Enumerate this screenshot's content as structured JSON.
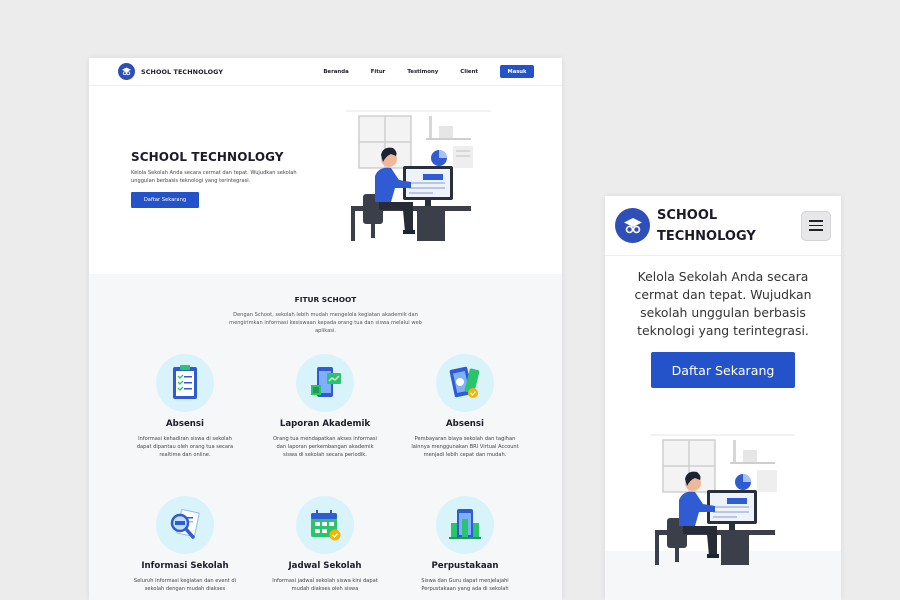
{
  "desktop": {
    "nav": {
      "brand": "SCHOOL TECHNOLOGY",
      "links": [
        "Beranda",
        "Fitur",
        "Testimony",
        "Client"
      ],
      "login": "Masuk"
    },
    "hero": {
      "title": "SCHOOL TECHNOLOGY",
      "description": "Kelola Sekolah Anda secara cermat dan tepat. Wujudkan sekolah unggulan berbasis teknologi yang terintegrasi.",
      "cta": "Daftar Sekarang"
    },
    "features": {
      "title": "FITUR SCHOOT",
      "description": "Dengan Schoot, sekolah lebih mudah mengelola kegiatan akademik dan mengirimkan informasi kesiswaan kepada orang tua dan siswa melalui web aplikasi.",
      "cards": [
        {
          "icon": "clipboard-checklist-icon",
          "title": "Absensi",
          "text": "Informasi kehadiran siswa di sekolah dapat dipantau oleh orang tua secara realtime dan online."
        },
        {
          "icon": "report-chart-icon",
          "title": "Laporan Akademik",
          "text": "Orang tua mendapatkan akses informasi dan laporan perkembangan akademik siswa di sekolah secara periodik."
        },
        {
          "icon": "payment-card-icon",
          "title": "Absensi",
          "text": "Pembayaran biaya sekolah dan tagihan lainnya menggunakan BRI Virtual Account menjadi lebih cepat dan mudah."
        },
        {
          "icon": "magnifier-document-icon",
          "title": "Informasi Sekolah",
          "text": "Seluruh informasi kegiatan dan event di sekolah dengan mudah diakses"
        },
        {
          "icon": "calendar-icon",
          "title": "Jadwal Sekolah",
          "text": "Informasi jadwal sekolah siswa kini dapat mudah diakses oleh siswa"
        },
        {
          "icon": "library-books-icon",
          "title": "Perpustakaan",
          "text": "Siswa dan Guru dapat menjelajahi Perpustakaan yang ada di sekolah"
        }
      ]
    }
  },
  "mobile": {
    "brand": "SCHOOL TECHNOLOGY",
    "description": "Kelola Sekolah Anda secara cermat dan tepat. Wujudkan sekolah unggulan berbasis teknologi yang terintegrasi.",
    "cta": "Daftar Sekarang"
  },
  "colors": {
    "accent": "#2452c9",
    "logo": "#2f4fb8",
    "icon_circle": "#d8f4fa",
    "section_bg": "#f6f7f9"
  }
}
